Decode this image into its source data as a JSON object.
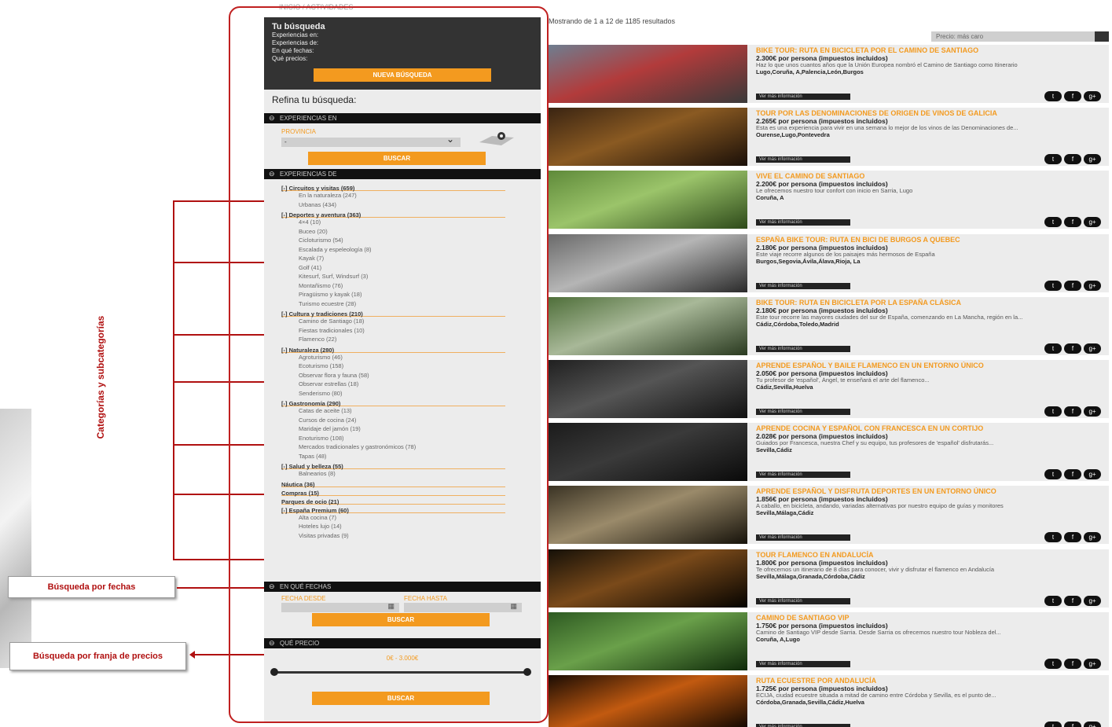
{
  "breadcrumb": "INICIO / ACTIVIDADES",
  "search": {
    "title": "Tu búsqueda",
    "lines": [
      "Experiencias en:",
      "Experiencias de:",
      "En qué fechas:",
      "Qué precios:"
    ],
    "new_button": "NUEVA BÚSQUEDA"
  },
  "refine_title": "Refina tu búsqueda:",
  "sections": {
    "experiencias_en": "EXPERIENCIAS EN",
    "experiencias_de": "EXPERIENCIAS DE",
    "fechas": "EN QUÉ FECHAS",
    "precio": "QUÉ PRECIO"
  },
  "province": {
    "label": "PROVINCIA",
    "value": "-",
    "search_button": "BUSCAR"
  },
  "categories": [
    {
      "name": "[-] Circuitos y visitas (659)",
      "subs": [
        "En la naturaleza (247)",
        "Urbanas (434)"
      ]
    },
    {
      "name": "[-] Deportes y aventura (363)",
      "subs": [
        "4×4 (10)",
        "Buceo (20)",
        "Cicloturismo (54)",
        "Escalada y espeleología (8)",
        "Kayak (7)",
        "Golf (41)",
        "Kitesurf, Surf, Windsurf (3)",
        "Montañismo (76)",
        "Piragüismo y kayak (18)",
        "Turismo ecuestre (28)"
      ]
    },
    {
      "name": "[-] Cultura y tradiciones (210)",
      "subs": [
        "Camino de Santiago (18)",
        "Fiestas tradicionales (10)",
        "Flamenco (22)"
      ]
    },
    {
      "name": "[-] Naturaleza (280)",
      "subs": [
        "Agroturismo (46)",
        "Ecoturismo (158)",
        "Observar flora y fauna (58)",
        "Observar estrellas (18)",
        "Senderismo (80)"
      ]
    },
    {
      "name": "[-] Gastronomía (290)",
      "subs": [
        "Catas de aceite (13)",
        "Cursos de cocina (24)",
        "Maridaje del jamón (19)",
        "Enoturismo (108)",
        "Mercados tradicionales y gastronómicos (78)",
        "Tapas (48)"
      ]
    },
    {
      "name": "[-] Salud y belleza (55)",
      "subs": [
        "Balnearios (8)"
      ]
    },
    {
      "name": "Náutica (36)",
      "subs": []
    },
    {
      "name": "Compras (15)",
      "subs": []
    },
    {
      "name": "Parques de ocio (21)",
      "subs": []
    },
    {
      "name": "[-] España Premium (60)",
      "subs": [
        "Alta cocina (7)",
        "Hoteles lujo (14)",
        "Visitas privadas (9)"
      ]
    }
  ],
  "dates": {
    "from_label": "FECHA DESDE",
    "to_label": "FECHA HASTA",
    "search_button": "BUSCAR"
  },
  "price": {
    "range": "0€ - 3.000€",
    "search_button": "BUSCAR",
    "min_frac": 0.0,
    "max_frac": 1.0
  },
  "annotations": {
    "categories": "Categorías y subcategorías",
    "dates": "Búsqueda por fechas",
    "prices": "Búsqueda por franja de precios"
  },
  "results": {
    "header": "Mostrando de 1 a 12 de 1185 resultados",
    "sort_placeholder": "Precio: más caro",
    "more_label": "Ver más información",
    "items": [
      {
        "title": "BIKE TOUR: RUTA EN BICICLETA POR EL CAMINO DE SANTIAGO",
        "price": "2.300€ por persona (impuestos incluidos)",
        "desc": "Haz lo que unos cuantos años que la Unión Europea nombró el Camino de Santiago como Itinerario",
        "places": "Lugo,Coruña, A,Palencia,León,Burgos"
      },
      {
        "title": "TOUR POR LAS DENOMINACIONES DE ORIGEN DE VINOS DE GALICIA",
        "price": "2.265€ por persona (impuestos incluidos)",
        "desc": "Esta es una experiencia para vivir en una semana lo mejor de los vinos de las Denominaciones de...",
        "places": "Ourense,Lugo,Pontevedra"
      },
      {
        "title": "VIVE EL CAMINO DE SANTIAGO",
        "price": "2.200€ por persona (impuestos incluidos)",
        "desc": "Le ofrecemos nuestro tour confort con inicio en Sarria, Lugo",
        "places": "Coruña, A"
      },
      {
        "title": "ESPAÑA BIKE TOUR: RUTA EN BICI DE BURGOS A QUEBEC",
        "price": "2.180€ por persona (impuestos incluidos)",
        "desc": "Este viaje recorre algunos de los paisajes más hermosos de España",
        "places": "Burgos,Segovia,Ávila,Álava,Rioja, La"
      },
      {
        "title": "BIKE TOUR: RUTA EN BICICLETA POR LA ESPAÑA CLÁSICA",
        "price": "2.180€ por persona (impuestos incluidos)",
        "desc": "Este tour recorre las mayores ciudades del sur de España, comenzando en La Mancha, región en la...",
        "places": "Cádiz,Córdoba,Toledo,Madrid"
      },
      {
        "title": "APRENDE ESPAÑOL Y BAILE FLAMENCO EN UN ENTORNO ÚNICO",
        "price": "2.050€ por persona (impuestos incluidos)",
        "desc": "Tu profesor de 'español', Ángel, te enseñará el arte del flamenco...",
        "places": "Cádiz,Sevilla,Huelva"
      },
      {
        "title": "APRENDE COCINA Y ESPAÑOL CON FRANCESCA EN UN CORTIJO",
        "price": "2.028€ por persona (impuestos incluidos)",
        "desc": "Guiados por Francesca, nuestra Chef y su equipo, tus profesores de 'español' disfrutarás...",
        "places": "Sevilla,Cádiz"
      },
      {
        "title": "APRENDE ESPAÑOL Y DISFRUTA DEPORTES EN UN ENTORNO ÚNICO",
        "price": "1.856€ por persona (impuestos incluidos)",
        "desc": "A caballo, en bicicleta, andando, variadas alternativas por nuestro equipo de guías y monitores",
        "places": "Sevilla,Málaga,Cádiz"
      },
      {
        "title": "TOUR FLAMENCO EN ANDALUCÍA",
        "price": "1.800€ por persona (impuestos incluidos)",
        "desc": "Te ofrecemos un itinerario de 8 días para conocer, vivir y disfrutar el flamenco en Andalucía",
        "places": "Sevilla,Málaga,Granada,Córdoba,Cádiz"
      },
      {
        "title": "CAMINO DE SANTIAGO VIP",
        "price": "1.750€ por persona (impuestos incluidos)",
        "desc": "Camino de Santiago VIP desde Sarria. Desde Sarria os ofrecemos nuestro tour Nobleza del...",
        "places": "Coruña, A,Lugo"
      },
      {
        "title": "RUTA ECUESTRE POR ANDALUCÍA",
        "price": "1.725€ por persona (impuestos incluidos)",
        "desc": "ECIJA, ciudad ecuestre situada a mitad de camino entre Córdoba y Sevilla, es el punto de...",
        "places": "Córdoba,Granada,Sevilla,Cádiz,Huelva"
      }
    ]
  },
  "colors": {
    "accent": "#f39a1f",
    "annotation": "#b01010",
    "sidebar_bg": "#ececec",
    "dark": "#333333"
  }
}
